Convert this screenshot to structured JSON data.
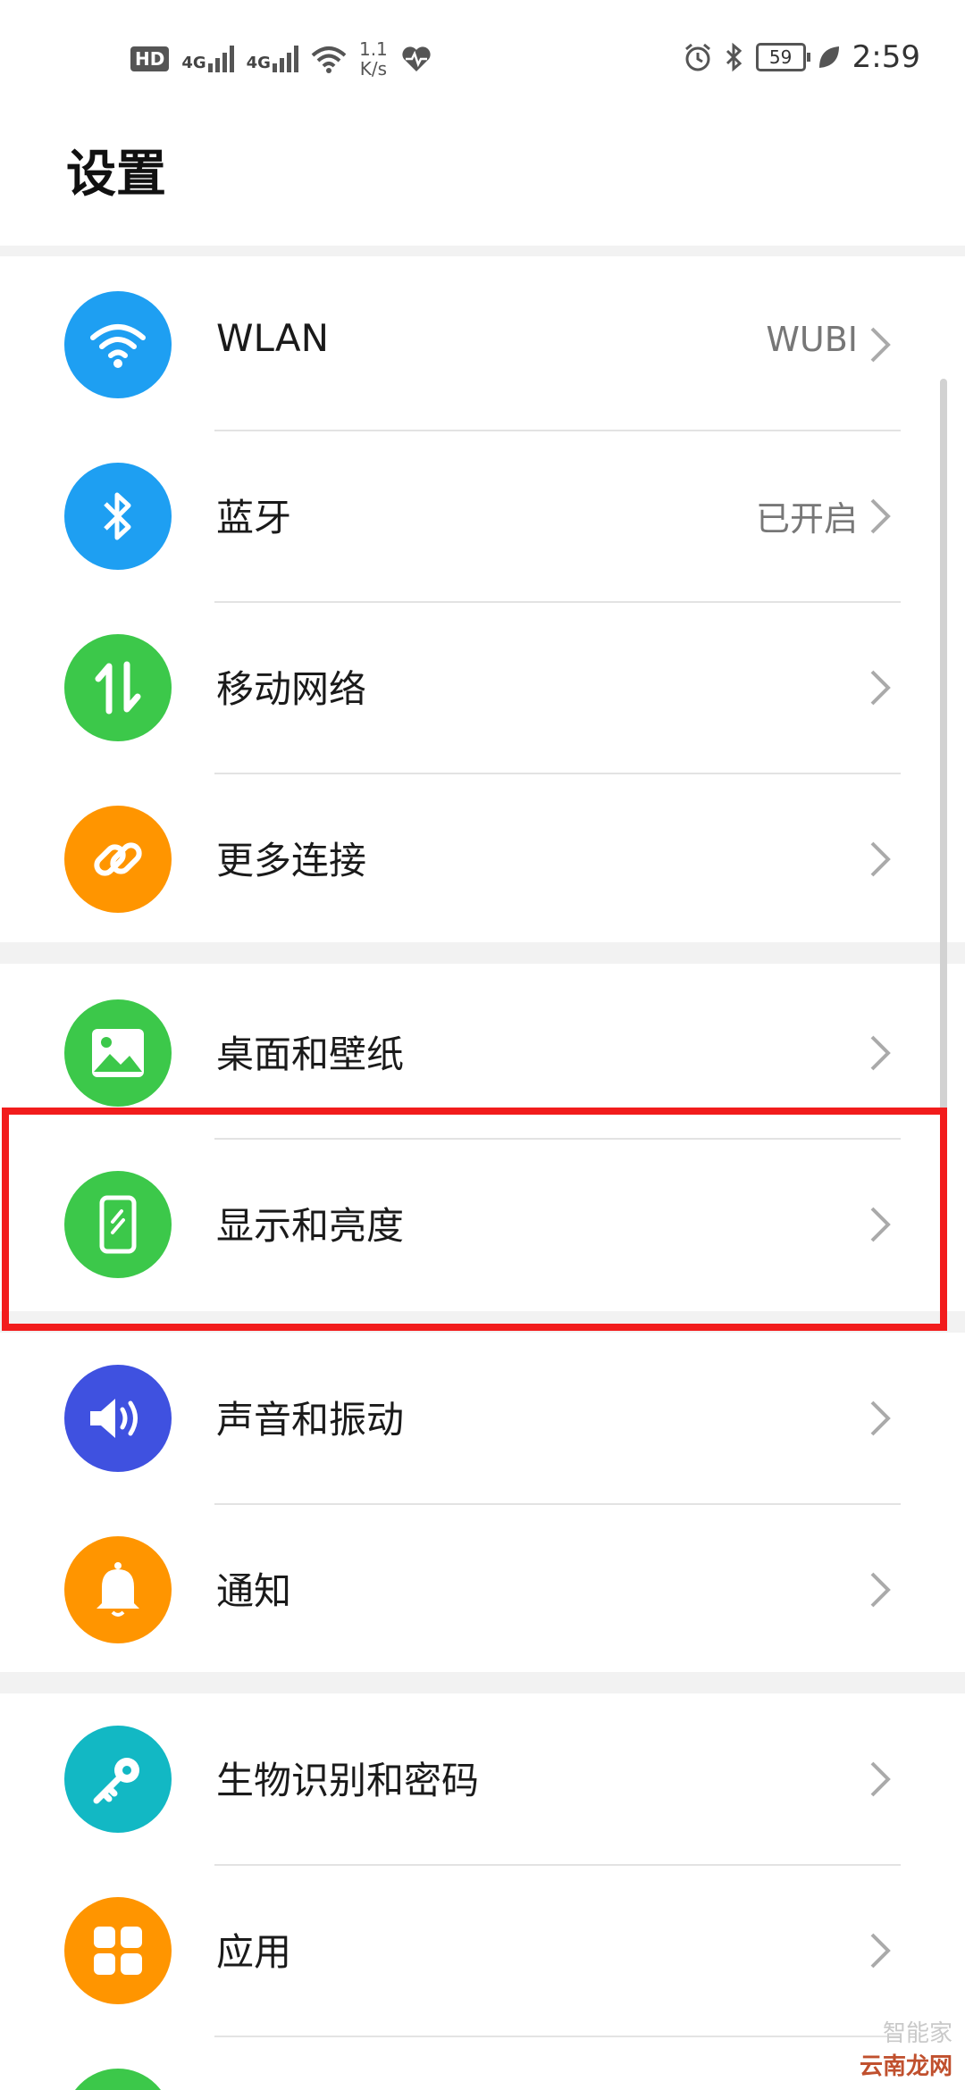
{
  "status_bar": {
    "hd_badge": "HD",
    "sim1": "4G",
    "sim2": "4G",
    "speed_value": "1.1",
    "speed_unit": "K/s",
    "battery": "59",
    "time": "2:59"
  },
  "page": {
    "title": "设置"
  },
  "sections": [
    {
      "items": [
        {
          "label": "WLAN",
          "value": "WUBI",
          "icon": "wifi-icon",
          "color": "#1e9ff2"
        },
        {
          "label": "蓝牙",
          "value": "已开启",
          "icon": "bluetooth-icon",
          "color": "#1e9ff2"
        },
        {
          "label": "移动网络",
          "value": "",
          "icon": "mobile-data-icon",
          "color": "#3cc84a"
        },
        {
          "label": "更多连接",
          "value": "",
          "icon": "link-icon",
          "color": "#ff9500"
        }
      ]
    },
    {
      "items": [
        {
          "label": "桌面和壁纸",
          "value": "",
          "icon": "picture-icon",
          "color": "#3cc84a"
        },
        {
          "label": "显示和亮度",
          "value": "",
          "icon": "display-icon",
          "color": "#3cc84a"
        }
      ]
    },
    {
      "items": [
        {
          "label": "声音和振动",
          "value": "",
          "icon": "speaker-icon",
          "color": "#3f51e0"
        },
        {
          "label": "通知",
          "value": "",
          "icon": "bell-icon",
          "color": "#ff9500"
        }
      ]
    },
    {
      "items": [
        {
          "label": "生物识别和密码",
          "value": "",
          "icon": "key-icon",
          "color": "#12b8c4"
        },
        {
          "label": "应用",
          "value": "",
          "icon": "apps-icon",
          "color": "#ff9500"
        }
      ]
    }
  ],
  "highlight": {
    "color": "#f21c1c",
    "target": "显示和亮度"
  },
  "watermark": {
    "line1": "智能家",
    "line2": "云南龙网"
  }
}
